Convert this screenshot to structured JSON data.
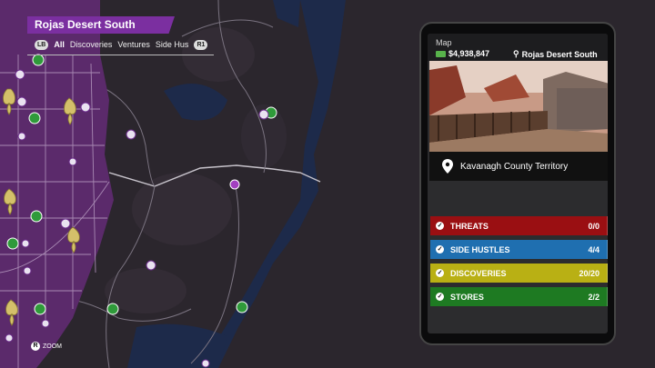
{
  "map": {
    "region": "Rojas Desert South",
    "filter_badge_left": "LB",
    "filter_badge_right": "R1",
    "filters": [
      "All",
      "Discoveries",
      "Ventures",
      "Side Hus"
    ],
    "zoom_key": "R",
    "zoom_label": "ZOOM"
  },
  "phone": {
    "app_title": "Map",
    "money": "$4,938,847",
    "location": "Rojas Desert South",
    "territory": "Kavanagh County Territory",
    "categories": [
      {
        "name": "THREATS",
        "count": "0/0",
        "color": "#9a0f12"
      },
      {
        "name": "SIDE HUSTLES",
        "count": "4/4",
        "color": "#1f6fb0"
      },
      {
        "name": "DISCOVERIES",
        "count": "20/20",
        "color": "#b9b014"
      },
      {
        "name": "STORES",
        "count": "2/2",
        "color": "#1e7a22"
      }
    ]
  },
  "colors": {
    "territory_purple": "#5b2a6b",
    "water": "#1d2a4a",
    "land": "#2b262d",
    "accent": "#7b2fa0"
  },
  "icons": [
    "fleur-de-lis-icon",
    "store-icon",
    "vehicle-icon",
    "discovery-icon",
    "cash-icon",
    "location-pin-icon"
  ]
}
